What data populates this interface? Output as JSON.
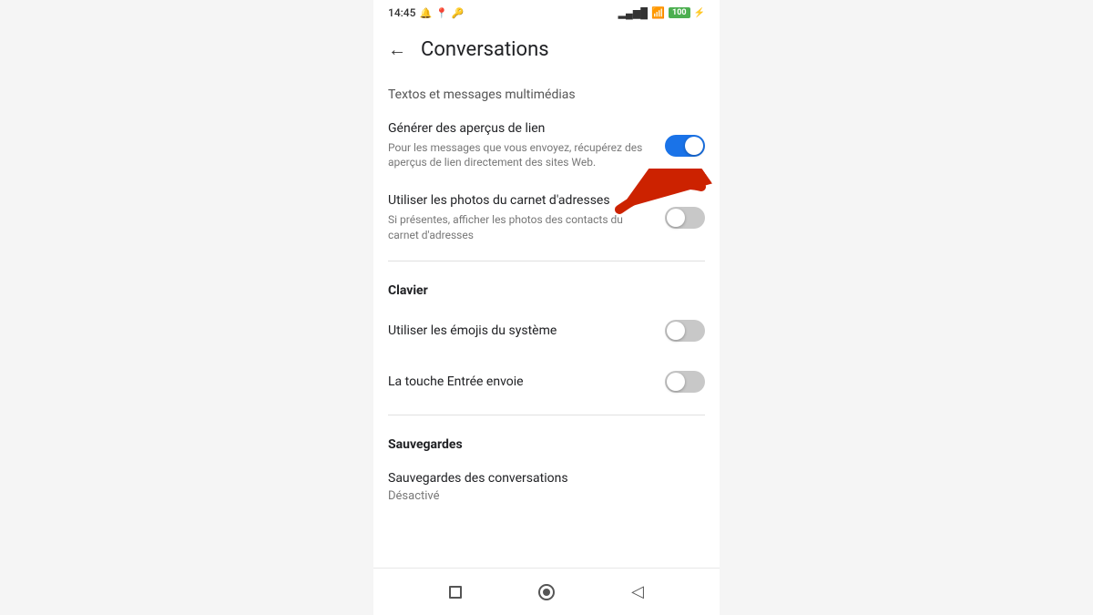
{
  "statusBar": {
    "time": "14:45",
    "battery": "100",
    "icons": [
      "notification",
      "location",
      "key"
    ]
  },
  "appBar": {
    "backLabel": "←",
    "title": "Conversations"
  },
  "sections": {
    "textos": {
      "label": "Textos et messages multimédias"
    },
    "settings": [
      {
        "id": "generer-apercus",
        "label": "Générer des aperçus de lien",
        "description": "Pour les messages que vous envoyez, récupérez des aperçus de lien directement des sites Web.",
        "toggleState": "on"
      },
      {
        "id": "utiliser-photos",
        "label": "Utiliser les photos du carnet d'adresses",
        "description": "Si présentes, afficher les photos des contacts du carnet d'adresses",
        "toggleState": "off"
      }
    ],
    "clavier": {
      "title": "Clavier",
      "items": [
        {
          "id": "emojis-systeme",
          "label": "Utiliser les émojis du système",
          "toggleState": "off"
        },
        {
          "id": "touche-entree",
          "label": "La touche Entrée envoie",
          "toggleState": "off"
        }
      ]
    },
    "sauvegardes": {
      "title": "Sauvegardes",
      "items": [
        {
          "id": "sauvegardes-conversations",
          "label": "Sauvegardes des conversations",
          "sublabel": "Désactivé"
        }
      ]
    }
  },
  "bottomNav": {
    "square": "■",
    "circle": "○",
    "back": "◁"
  }
}
